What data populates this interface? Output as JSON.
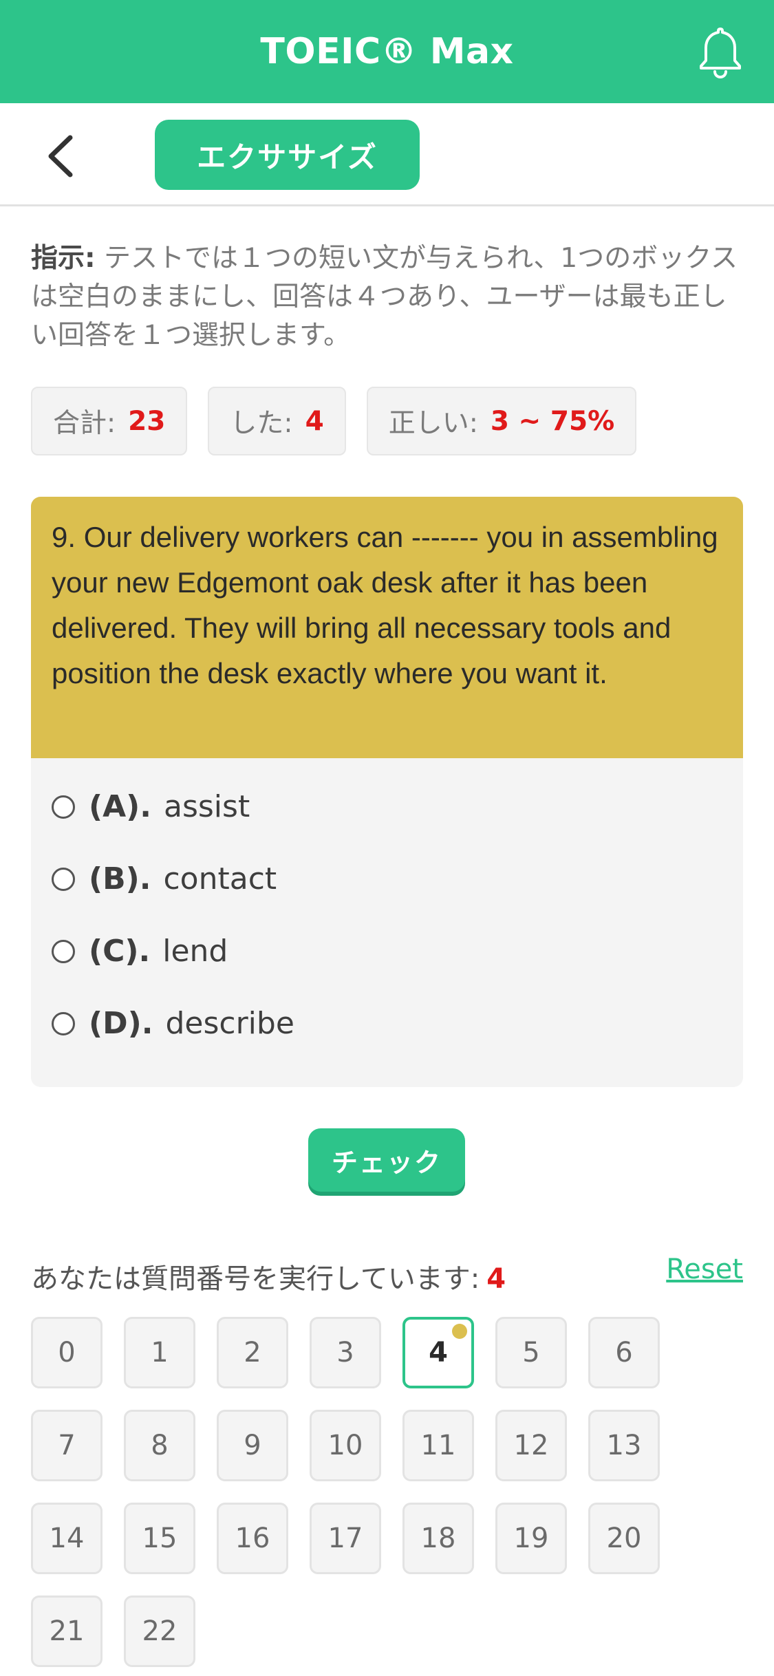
{
  "header": {
    "title": "TOEIC® Max",
    "icon": "bell-icon"
  },
  "subheader": {
    "back_icon": "chevron-left-icon",
    "tag_label": "エクササイズ"
  },
  "instructions": {
    "label": "指示:",
    "text": " テストでは１つの短い文が与えられ、1つのボックスは空白のままにし、回答は４つあり、ユーザーは最も正しい回答を１つ選択します。"
  },
  "stats": {
    "total_label": "合計:",
    "total_value": "23",
    "done_label": "した:",
    "done_value": "4",
    "correct_label": "正しい:",
    "correct_value": "3 ~ 75%"
  },
  "question": {
    "text": "9. Our delivery workers can ------- you in assembling your new Edgemont oak desk after it has been delivered. They will bring all necessary tools and position the desk exactly where you want it.",
    "options": [
      {
        "letter": "(A).",
        "text": "assist"
      },
      {
        "letter": "(B).",
        "text": "contact"
      },
      {
        "letter": "(C).",
        "text": "lend"
      },
      {
        "letter": "(D).",
        "text": "describe"
      }
    ]
  },
  "check_button": "チェック",
  "progress": {
    "label": "あなたは質問番号を実行しています:",
    "current": "4",
    "reset_label": "Reset"
  },
  "grid": {
    "numbers": [
      "0",
      "1",
      "2",
      "3",
      "4",
      "5",
      "6",
      "7",
      "8",
      "9",
      "10",
      "11",
      "12",
      "13",
      "14",
      "15",
      "16",
      "17",
      "18",
      "19",
      "20",
      "21",
      "22"
    ],
    "active_index": 4
  },
  "colors": {
    "brand_green": "#2dc48a",
    "question_yellow": "#dbbf4f",
    "accent_red": "#e01a1a"
  }
}
